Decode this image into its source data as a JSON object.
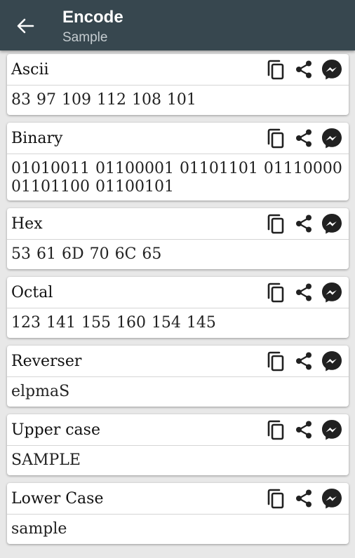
{
  "appbar": {
    "title": "Encode",
    "subtitle": "Sample"
  },
  "icons": {
    "back": "arrow-left-icon",
    "copy": "copy-icon",
    "share": "share-icon",
    "messenger": "messenger-icon"
  },
  "colors": {
    "appbar": "#37474f",
    "icon": "#212121"
  },
  "cards": [
    {
      "id": "ascii",
      "title": "Ascii",
      "value": "83 97 109 112 108 101"
    },
    {
      "id": "binary",
      "title": "Binary",
      "value": "01010011 01100001 01101101 01110000 01101100 01100101"
    },
    {
      "id": "hex",
      "title": "Hex",
      "value": "53 61 6D 70 6C 65"
    },
    {
      "id": "octal",
      "title": "Octal",
      "value": "123 141 155 160 154 145"
    },
    {
      "id": "reverser",
      "title": "Reverser",
      "value": "elpmaS"
    },
    {
      "id": "upper-case",
      "title": "Upper case",
      "value": "SAMPLE"
    },
    {
      "id": "lower-case",
      "title": "Lower Case",
      "value": "sample"
    }
  ]
}
